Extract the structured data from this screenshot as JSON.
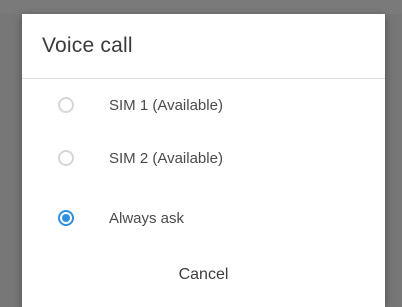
{
  "dialog": {
    "title": "Voice call",
    "options": [
      {
        "label": "SIM 1 (Available)",
        "selected": false
      },
      {
        "label": "SIM 2 (Available)",
        "selected": false
      },
      {
        "label": "Always ask",
        "selected": true
      }
    ],
    "cancel_label": "Cancel"
  },
  "colors": {
    "accent": "#2f8fe0",
    "overlay": "#6e6e6e"
  }
}
